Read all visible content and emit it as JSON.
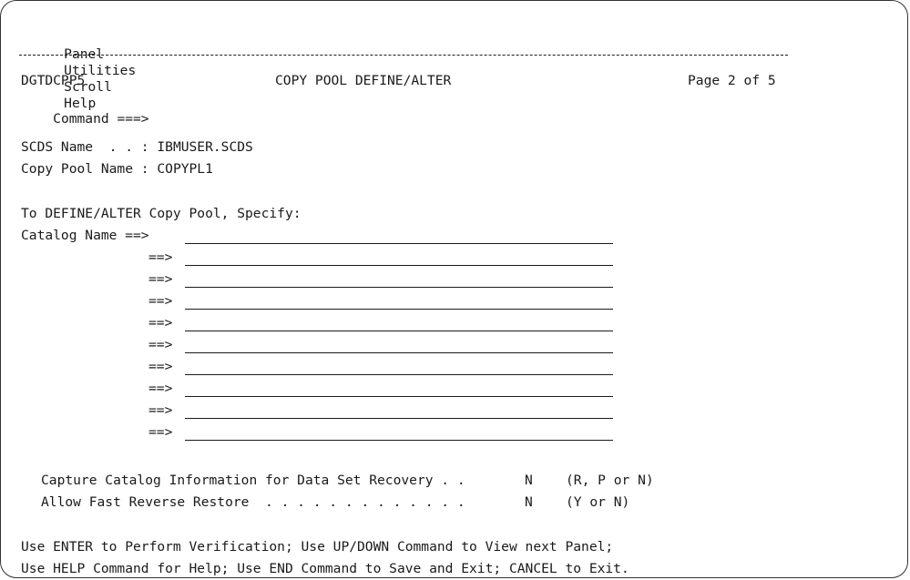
{
  "menu": {
    "items": [
      "Panel",
      "Utilities",
      "Scroll",
      "Help"
    ]
  },
  "header": {
    "panel_id": "DGTDCPP5",
    "title": "COPY POOL DEFINE/ALTER",
    "page": "Page 2 of 5",
    "command_label": "Command ===>"
  },
  "info": {
    "scds_label": "SCDS Name  . . : ",
    "scds_value": "IBMUSER.SCDS",
    "pool_label": "Copy Pool Name : ",
    "pool_value": "COPYPL1"
  },
  "form": {
    "intro": "To DEFINE/ALTER Copy Pool, Specify:",
    "catalog_label": "Catalog Name ==>",
    "arrow": "==>"
  },
  "options": {
    "capture_label": "Capture Catalog Information for Data Set Recovery . .",
    "capture_value": "N",
    "capture_hint": "(R, P or N)",
    "fast_label": "Allow Fast Reverse Restore  . . . . . . . . . . . . .",
    "fast_value": "N",
    "fast_hint": "(Y or N)"
  },
  "footer": {
    "line1": "Use ENTER to Perform Verification; Use UP/DOWN Command to View next Panel;",
    "line2": "Use HELP Command for Help; Use END Command to Save and Exit; CANCEL to Exit."
  }
}
